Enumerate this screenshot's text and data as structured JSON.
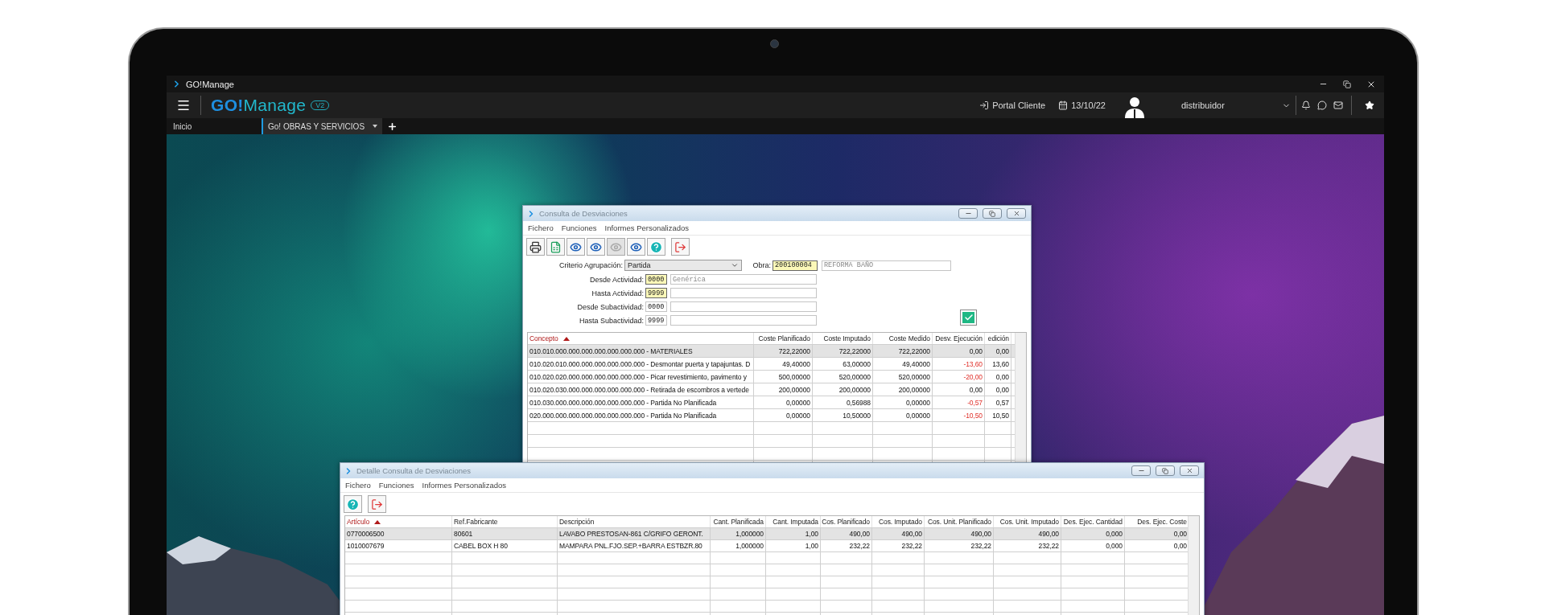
{
  "app": {
    "title": "GO!Manage",
    "logo": {
      "lead": "GO!",
      "rest": "Manage",
      "badge": "V2"
    },
    "portal": "Portal Cliente",
    "date": "13/10/22",
    "user": "distribuidor"
  },
  "tabs": [
    {
      "label": "Inicio",
      "selected": false
    },
    {
      "label": "Go! OBRAS Y SERVICIOS",
      "selected": true
    }
  ],
  "windows": [
    {
      "title": "Consulta de Desviaciones",
      "menu": [
        "Fichero",
        "Funciones",
        "Informes Personalizados"
      ],
      "toolbar": [
        {
          "kind": "print",
          "disabled": false
        },
        {
          "kind": "excel",
          "disabled": false
        },
        {
          "kind": "view",
          "disabled": false
        },
        {
          "kind": "view",
          "disabled": false
        },
        {
          "kind": "view",
          "disabled": true
        },
        {
          "kind": "view",
          "disabled": false
        },
        {
          "kind": "help",
          "disabled": false
        },
        {
          "kind": "exit",
          "disabled": false
        }
      ],
      "form": {
        "grouping": {
          "label": "Criterio Agrupación:",
          "value": "Partida"
        },
        "obra": {
          "label": "Obra:",
          "code": "200100004",
          "name": "REFORMA BAÑO",
          "highlighted": true
        },
        "ranges": [
          {
            "label": "Desde Actividad:",
            "code": "0000",
            "name": "Genérica",
            "highlighted": true
          },
          {
            "label": "Hasta Actividad:",
            "code": "9999",
            "highlighted": true
          },
          {
            "label": "Desde Subactividad:",
            "code": "0000",
            "highlighted": false
          },
          {
            "label": "Hasta Subactividad:",
            "code": "9999",
            "highlighted": false
          }
        ],
        "confirm": {
          "checked": true
        }
      },
      "table": {
        "columns": [
          {
            "label": "Concepto",
            "kind": "text",
            "sorted": true
          },
          {
            "label": "Coste Planificado",
            "kind": "number",
            "sorted": false
          },
          {
            "label": "Coste Imputado",
            "kind": "number",
            "sorted": false
          },
          {
            "label": "Coste Medido",
            "kind": "number",
            "sorted": false
          },
          {
            "label": "Desv. Ejecución",
            "kind": "deviation",
            "sorted": false
          },
          {
            "label": "edición",
            "kind": "number",
            "sorted": false
          }
        ],
        "rows": [
          {
            "selected": true,
            "negative": false,
            "cells": [
              "010.010.000.000.000.000.000.000.000 - MATERIALES",
              "722,22000",
              "722,22000",
              "722,22000",
              "0,00",
              "0,00"
            ]
          },
          {
            "selected": false,
            "negative": true,
            "cells": [
              "010.020.010.000.000.000.000.000.000 - Desmontar puerta y tapajuntas. D",
              "49,40000",
              "63,00000",
              "49,40000",
              "-13,60",
              "13,60"
            ]
          },
          {
            "selected": false,
            "negative": true,
            "cells": [
              "010.020.020.000.000.000.000.000.000 - Picar revestimiento, pavimento y",
              "500,00000",
              "520,00000",
              "520,00000",
              "-20,00",
              "0,00"
            ]
          },
          {
            "selected": false,
            "negative": false,
            "cells": [
              "010.020.030.000.000.000.000.000.000 - Retirada de escombros a vertede",
              "200,00000",
              "200,00000",
              "200,00000",
              "0,00",
              "0,00"
            ]
          },
          {
            "selected": false,
            "negative": true,
            "cells": [
              "010.030.000.000.000.000.000.000.000 - Partida No Planificada",
              "0,00000",
              "0,56988",
              "0,00000",
              "-0,57",
              "0,57"
            ]
          },
          {
            "selected": false,
            "negative": true,
            "cells": [
              "020.000.000.000.000.000.000.000.000 - Partida No Planificada",
              "0,00000",
              "10,50000",
              "0,00000",
              "-10,50",
              "10,50"
            ]
          }
        ]
      }
    },
    {
      "title": "Detalle Consulta de Desviaciones",
      "menu": [
        "Fichero",
        "Funciones",
        "Informes Personalizados"
      ],
      "toolbar": [
        {
          "kind": "help",
          "disabled": false
        },
        {
          "kind": "exit",
          "disabled": false
        }
      ],
      "table": {
        "columns": [
          {
            "label": "Artículo",
            "kind": "text",
            "sorted": true
          },
          {
            "label": "Ref.Fabricante",
            "kind": "text",
            "sorted": false
          },
          {
            "label": "Descripción",
            "kind": "text",
            "sorted": false
          },
          {
            "label": "Cant. Planificada",
            "kind": "number",
            "sorted": false
          },
          {
            "label": "Cant. Imputada",
            "kind": "number",
            "sorted": false
          },
          {
            "label": "Cos. Planificado",
            "kind": "number",
            "sorted": false
          },
          {
            "label": "Cos. Imputado",
            "kind": "number",
            "sorted": false
          },
          {
            "label": "Cos. Unit. Planificado",
            "kind": "number",
            "sorted": false
          },
          {
            "label": "Cos. Unit. Imputado",
            "kind": "number",
            "sorted": false
          },
          {
            "label": "Des. Ejec. Cantidad",
            "kind": "number",
            "sorted": false
          },
          {
            "label": "Des. Ejec. Coste",
            "kind": "number",
            "sorted": false
          }
        ],
        "rows": [
          {
            "selected": true,
            "cells": [
              "0770006500",
              "80601",
              "LAVABO PRESTOSAN-861 C/GRIFO GERONT.",
              "1,000000",
              "1,00",
              "490,00",
              "490,00",
              "490,00",
              "490,00",
              "0,000",
              "0,00"
            ]
          },
          {
            "selected": false,
            "cells": [
              "1010007679",
              "CABEL BOX H 80",
              "MAMPARA PNL.FJO.SEP.+BARRA ESTBZR.80",
              "1,000000",
              "1,00",
              "232,22",
              "232,22",
              "232,22",
              "232,22",
              "0,000",
              "0,00"
            ]
          }
        ]
      }
    }
  ]
}
